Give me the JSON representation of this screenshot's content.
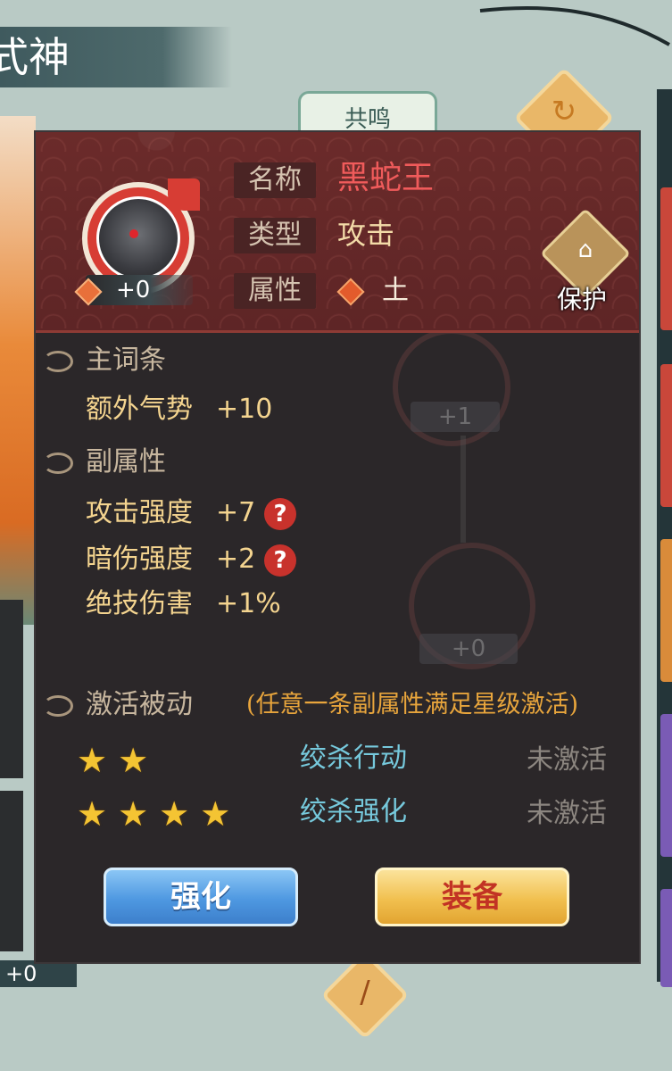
{
  "background": {
    "page_title": "式神",
    "tab_label": "共鸣",
    "left_level": "+0"
  },
  "panel": {
    "header": {
      "level": "+0",
      "name_label": "名称",
      "name": "黑蛇王",
      "type_label": "类型",
      "type": "攻击",
      "attribute_label": "属性",
      "attribute": "土",
      "protect_label": "保护"
    },
    "main_entry": {
      "title": "主词条",
      "stat": {
        "name": "额外气势",
        "value": "+10"
      }
    },
    "sub_attributes": {
      "title": "副属性",
      "stats": [
        {
          "name": "攻击强度",
          "value": "+7"
        },
        {
          "name": "暗伤强度",
          "value": "+2"
        },
        {
          "name": "绝技伤害",
          "value": "+1%"
        }
      ]
    },
    "passive": {
      "title": "激活被动",
      "hint": "(任意一条副属性满足星级激活)",
      "items": [
        {
          "stars": 2,
          "name": "绞杀行动",
          "status": "未激活"
        },
        {
          "stars": 4,
          "name": "绞杀强化",
          "status": "未激活"
        }
      ]
    },
    "buttons": {
      "enhance": "强化",
      "equip": "装备"
    },
    "ghost_levels": [
      "+1",
      "+0"
    ]
  },
  "colors": {
    "name": "#f05b5b",
    "stat": "#f4d48f",
    "passive_name": "#76c9dc",
    "star": "#f4c433",
    "hint": "#e8a53c"
  }
}
